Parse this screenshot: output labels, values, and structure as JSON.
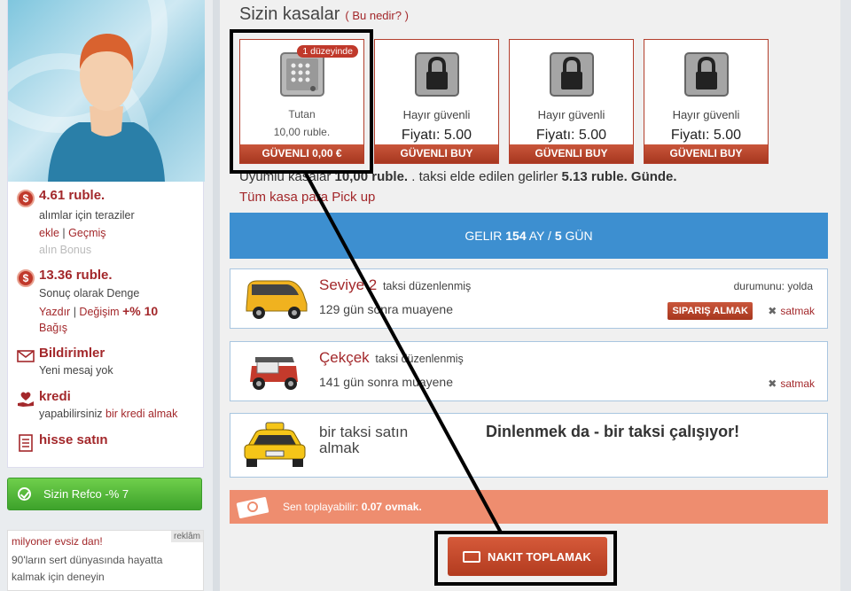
{
  "sidebar": {
    "balance": {
      "title": "4.61 ruble.",
      "desc": "alımlar için teraziler",
      "link_add": "ekle",
      "sep": "|",
      "link_history": "Geçmiş",
      "bonus": "alın Bonus"
    },
    "balance2": {
      "title": "13.36 ruble.",
      "desc": "Sonuç olarak Denge",
      "link_print": "Yazdır",
      "sep": "|",
      "link_change": "Değişim",
      "percent": "+% 10",
      "link_bag": "Bağış"
    },
    "notifications": {
      "title": "Bildirimler",
      "desc": "Yeni mesaj yok"
    },
    "credit": {
      "title": "kredi",
      "desc": "yapabilirsiniz",
      "link": "bir kredi almak"
    },
    "shares": {
      "title": "hisse satın"
    },
    "refco": {
      "label": "Sizin Refco -% 7"
    },
    "ad": {
      "tag": "reklâm",
      "title": "milyoner evsiz dan!",
      "body": "90'ların sert dünyasında hayatta kalmak için deneyin"
    }
  },
  "main": {
    "title": "Sizin kasalar",
    "what_link": "( Bu nedir? )",
    "safes": [
      {
        "badge": "1 düzeyinde",
        "label": "Tutan",
        "sub": "10,00 ruble.",
        "button": "GÜVENLI 0,00 €",
        "locked": false
      },
      {
        "label": "Hayır güvenli",
        "price": "Fiyatı: 5.00",
        "button": "GÜVENLI BUY",
        "locked": true
      },
      {
        "label": "Hayır güvenli",
        "price": "Fiyatı: 5.00",
        "button": "GÜVENLI BUY",
        "locked": true
      },
      {
        "label": "Hayır güvenli",
        "price": "Fiyatı: 5.00",
        "button": "GÜVENLI BUY",
        "locked": true
      }
    ],
    "income": {
      "pre": "Uyumlu kasalar",
      "amount": "10,00 ruble.",
      "mid": ". taksi elde edilen gelirler",
      "daily": "5.13 ruble. Günde."
    },
    "pickup_link": "Tüm kasa para Pick up",
    "gelir": {
      "pre": "GELIR",
      "months": "154",
      "ay": "AY /",
      "days": "5",
      "gun": "GÜN"
    },
    "taxis": [
      {
        "name": "Seviye 2",
        "note": "taksi düzenlenmiş",
        "sub": "129 gün sonra muayene",
        "state": "durumunu: yolda",
        "order": "SIPARIŞ ALMAK",
        "sell": "satmak"
      },
      {
        "name": "Çekçek",
        "note": "taksi düzenlenmiş",
        "sub": "141 gün sonra muayene",
        "sell": "satmak"
      }
    ],
    "buy": {
      "name": "bir taksi satın almak",
      "msg": "Dinlenmek da - bir taksi çalışıyor!"
    },
    "collect": {
      "pre": "Sen toplayabilir:",
      "value": "0.07 ovmak."
    },
    "collect_button": "NAKIT TOPLAMAK"
  }
}
